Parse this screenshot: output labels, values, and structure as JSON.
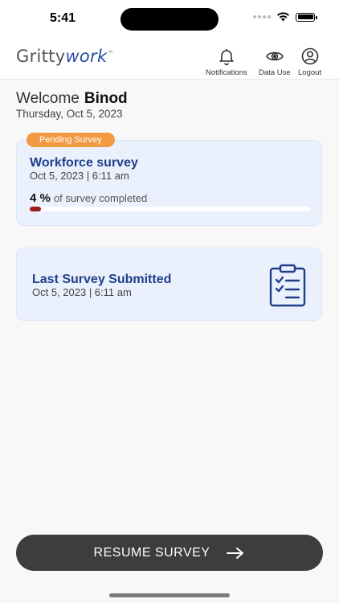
{
  "status_bar": {
    "time": "5:41"
  },
  "header": {
    "logo_text_main": "Gritty",
    "logo_text_accent": "work",
    "logo_tm": "™",
    "nav": {
      "notifications_label": "Notifications",
      "data_use_label": "Data Use",
      "logout_label": "Logout"
    }
  },
  "welcome": {
    "greeting": "Welcome",
    "user_name": "Binod",
    "date": "Thursday, Oct 5, 2023"
  },
  "pending_survey": {
    "badge": "Pending Survey",
    "title": "Workforce survey",
    "datetime": "Oct 5, 2023 | 6:11 am",
    "progress_percent_label": "4 %",
    "progress_value": 4,
    "progress_suffix": "of survey completed"
  },
  "last_survey": {
    "title": "Last Survey Submitted",
    "datetime": "Oct 5, 2023 | 6:11 am"
  },
  "resume_button": {
    "label": "RESUME SURVEY"
  },
  "colors": {
    "accent_blue": "#1f3f8a",
    "badge_orange": "#f19a41",
    "progress_red": "#9b1b1b",
    "card_bg": "#eaf1fd",
    "button_dark": "#3d3d3d"
  },
  "icons": [
    "bell-icon",
    "eye-icon",
    "user-icon",
    "clipboard-icon",
    "arrow-right-icon",
    "wifi-icon",
    "battery-icon"
  ]
}
